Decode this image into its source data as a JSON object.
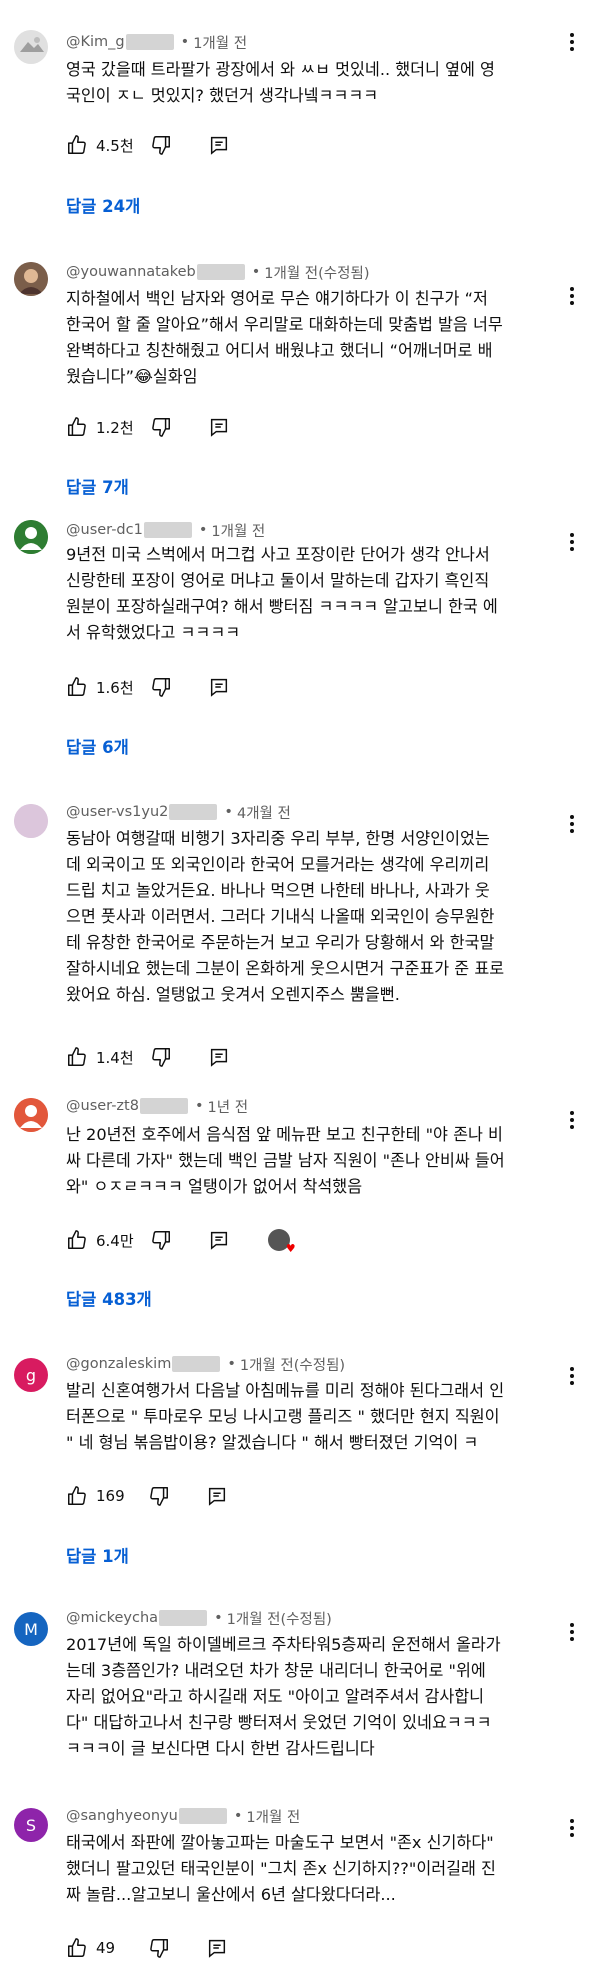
{
  "comments": [
    {
      "handle": "@Kim_g",
      "time": "1개월 전",
      "edited": "",
      "avatar_letter": "",
      "lines": [
        "영국 갔을때 트라팔가 광장에서 와 ㅆㅂ 멋있네.. 했더니 옆에 영",
        "국인이 ㅈㄴ 멋있지? 했던거 생각나넼ㅋㅋㅋㅋ"
      ],
      "likes": "4.5천",
      "replies": "답글 24개"
    },
    {
      "handle": "@youwannatakeb",
      "time": "1개월 전(수정됨)",
      "edited": "",
      "avatar_letter": "",
      "lines": [
        "지하철에서 백인 남자와 영어로 무슨 얘기하다가 이 친구가 “저",
        "한국어 할 줄 알아요”해서 우리말로 대화하는데 맞춤법 발음 너무",
        "완벽하다고 칭찬해줬고 어디서 배웠냐고 했더니 “어깨너머로 배",
        "웠습니다”😂실화임"
      ],
      "likes": "1.2천",
      "replies": "답글 7개"
    },
    {
      "handle": "@user-dc1",
      "time": "1개월 전",
      "edited": "",
      "avatar_letter": "",
      "lines": [
        "9년전 미국 스벅에서 머그컵 사고 포장이란 단어가 생각 안나서",
        "신랑한테 포장이 영어로 머냐고 둘이서 말하는데  갑자기 흑인직",
        "원분이 포장하실래구여? 해서 빵터짐 ㅋㅋㅋㅋ 알고보니 한국 에",
        "서 유학했었다고 ㅋㅋㅋㅋ"
      ],
      "likes": "1.6천",
      "replies": "답글 6개"
    },
    {
      "handle": "@user-vs1yu2",
      "time": "4개월 전",
      "edited": "",
      "avatar_letter": "",
      "lines": [
        "동남아 여행갈때 비행기 3자리중 우리 부부, 한명 서양인이었는",
        "데 외국이고 또 외국인이라 한국어 모를거라는 생각에 우리끼리",
        "드립 치고 놀았거든요.  바나나 먹으면 나한테 바나나, 사과가 웃",
        "으면 풋사과 이러면서.  그러다 기내식 나올때 외국인이 승무원한",
        "테 유창한 한국어로  주문하는거 보고 우리가 당황해서 와 한국말",
        "잘하시네요 했는데 그분이 온화하게 웃으시면거 구준표가 준 표로",
        "왔어요 하심.  얼탱없고 웃겨서 오렌지주스 뿜을뻔."
      ],
      "likes": "1.4천",
      "replies": ""
    },
    {
      "handle": "@user-zt8",
      "time": "1년 전",
      "edited": "",
      "avatar_letter": "",
      "lines": [
        "난 20년전 호주에서 음식점 앞 메뉴판 보고 친구한테 \"야 존나 비",
        "싸 다른데 가자\" 했는데 백인 금발 남자 직원이 \"존나 안비싸 들어",
        "와\" ㅇㅈㄹㅋㅋㅋ 얼탱이가 없어서 착석했음"
      ],
      "likes": "6.4만",
      "replies": "답글 483개"
    },
    {
      "handle": "@gonzaleskim",
      "time": "1개월 전(수정됨)",
      "edited": "",
      "avatar_letter": "g",
      "lines": [
        "발리 신혼여행가서 다음날 아침메뉴를 미리 정해야 된다그래서 인",
        "터폰으로 \" 투마로우 모닝 나시고랭 플리즈 \" 했더만 현지 직원이",
        "\" 네 형님 볶음밥이용? 알겠습니다 \" 해서 빵터졌던 기억이 ㅋ"
      ],
      "likes": "169",
      "replies": "답글 1개"
    },
    {
      "handle": "@mickeycha",
      "time": "1개월 전(수정됨)",
      "edited": "",
      "avatar_letter": "M",
      "lines": [
        "2017년에 독일 하이델베르크 주차타워5층짜리 운전해서 올라가",
        "는데 3층쯤인가? 내려오던 차가 창문 내리더니 한국어로 \"위에",
        "자리 없어요\"라고 하시길래 저도 \"아이고 알려주셔서 감사합니",
        "다\" 대답하고나서 친구랑 빵터져서 웃었던 기억이 있네요ㅋㅋㅋ",
        "ㅋㅋㅋ이 글 보신다면 다시 한번 감사드립니다"
      ],
      "likes": "",
      "replies": ""
    },
    {
      "handle": "@sanghyeonyu",
      "time": "1개월 전",
      "edited": "",
      "avatar_letter": "S",
      "lines": [
        "태국에서 좌판에 깔아놓고파는 마술도구 보면서 \"존x 신기하다\"",
        "했더니 팔고있던 태국인분이 \"그치 존x 신기하지??\"이러길래 진",
        "짜 놀람...알고보니 울산에서 6년 살다왔다더라..."
      ],
      "likes": "49",
      "replies": ""
    }
  ],
  "colors": {
    "link": "#065fd4",
    "meta": "#606060",
    "avatar_green": "#2e7d32",
    "avatar_pink": "#d81b60",
    "avatar_blue": "#1565c0",
    "avatar_purple": "#8e24aa"
  }
}
